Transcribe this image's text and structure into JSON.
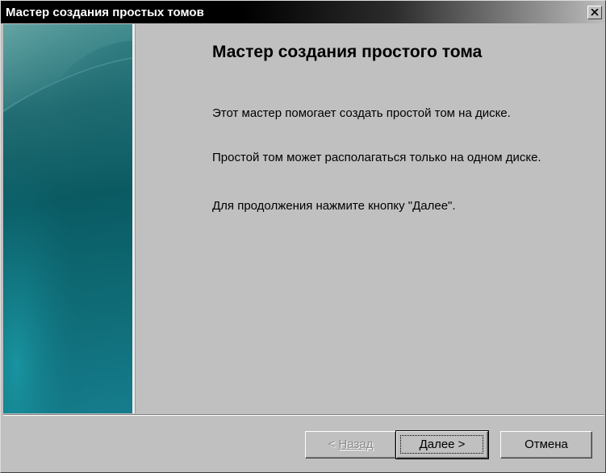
{
  "window": {
    "title": "Мастер создания простых томов"
  },
  "sidebar": {
    "icon": "wizard-banner-image"
  },
  "content": {
    "heading": "Мастер создания простого тома",
    "paragraph1": "Этот мастер помогает создать простой том на диске.",
    "paragraph2": "Простой том может располагаться только на одном диске.",
    "paragraph3": "Для продолжения нажмите кнопку \"Далее\"."
  },
  "buttons": {
    "back_prefix": "< ",
    "back_label": "Назад",
    "next_label": "Далее >",
    "cancel_label": "Отмена"
  },
  "colors": {
    "title_bar": "#000000",
    "face": "#c0c0c0",
    "sidebar_accent": "#0a5a62"
  }
}
